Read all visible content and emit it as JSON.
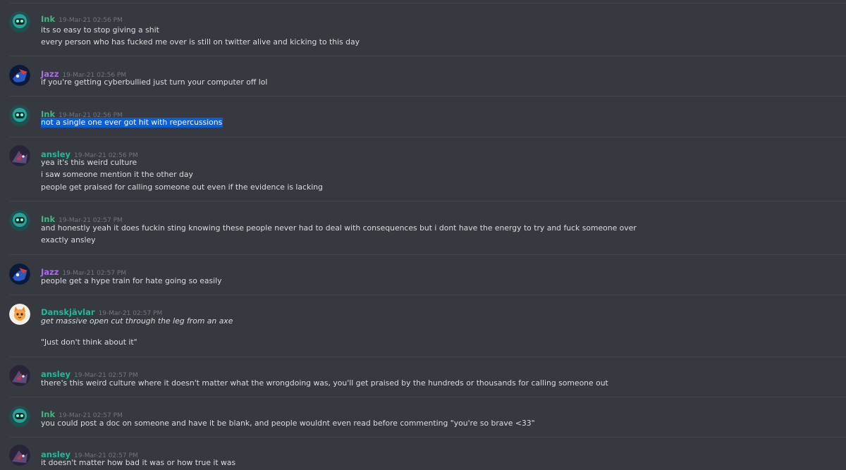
{
  "colors": {
    "background": "#36393f",
    "divider": "#42454a",
    "text": "#dcddde",
    "timestamp": "#72767d",
    "selection": "#0b5fd6",
    "author_ink": "#43b581",
    "author_jazz": "#b06af0",
    "author_ansley": "#1abc9c",
    "author_dansk": "#1abc9c"
  },
  "messages": [
    {
      "author": "Ink",
      "timestamp": "19-Mar-21 02:56 PM",
      "avatar_icon": "teal-robot-avatar-icon",
      "lines": [
        "its so easy to stop giving a shit",
        "every person who has fucked me over is still on twitter alive and kicking to this day"
      ]
    },
    {
      "author": "Jazz",
      "timestamp": "19-Mar-21 02:56 PM",
      "avatar_icon": "blue-red-character-avatar-icon",
      "lines": [
        "if you're getting cyberbullied just turn your computer off lol"
      ]
    },
    {
      "author": "Ink",
      "timestamp": "19-Mar-21 02:56 PM",
      "avatar_icon": "teal-robot-avatar-icon",
      "lines": [
        "not a single one ever got hit with repercussions"
      ],
      "selected": true
    },
    {
      "author": "ansley",
      "timestamp": "19-Mar-21 02:56 PM",
      "avatar_icon": "dark-character-avatar-icon",
      "lines": [
        "yea it's this weird culture",
        "i saw someone mention it the other day",
        "people get praised for calling someone out even if the evidence is lacking"
      ]
    },
    {
      "author": "Ink",
      "timestamp": "19-Mar-21 02:57 PM",
      "avatar_icon": "teal-robot-avatar-icon",
      "lines": [
        "and honestly yeah it does fuckin sting knowing these people never had to deal with consequences but i dont have the energy to try and fuck someone over",
        "exactly ansley"
      ]
    },
    {
      "author": "Jazz",
      "timestamp": "19-Mar-21 02:57 PM",
      "avatar_icon": "blue-red-character-avatar-icon",
      "lines": [
        "people get a hype train for hate going so easily"
      ]
    },
    {
      "author": "Danskjävlar",
      "timestamp": "19-Mar-21 02:57 PM",
      "avatar_icon": "orange-cat-avatar-icon",
      "lines": [
        "get massive open cut through the leg from an axe",
        "",
        "\"Just don't think about it\""
      ]
    },
    {
      "author": "ansley",
      "timestamp": "19-Mar-21 02:57 PM",
      "avatar_icon": "dark-character-avatar-icon",
      "lines": [
        "there's this weird culture where it doesn't matter what the wrongdoing was, you'll get praised by the hundreds or thousands for calling someone out"
      ]
    },
    {
      "author": "Ink",
      "timestamp": "19-Mar-21 02:57 PM",
      "avatar_icon": "teal-robot-avatar-icon",
      "lines": [
        "you could post a doc on someone and have it be blank, and people wouldnt even read before commenting \"you're so brave <33\""
      ]
    },
    {
      "author": "ansley",
      "timestamp": "19-Mar-21 02:57 PM",
      "avatar_icon": "dark-character-avatar-icon",
      "lines": [
        "it doesn't matter how bad it was or how true it was"
      ]
    }
  ]
}
